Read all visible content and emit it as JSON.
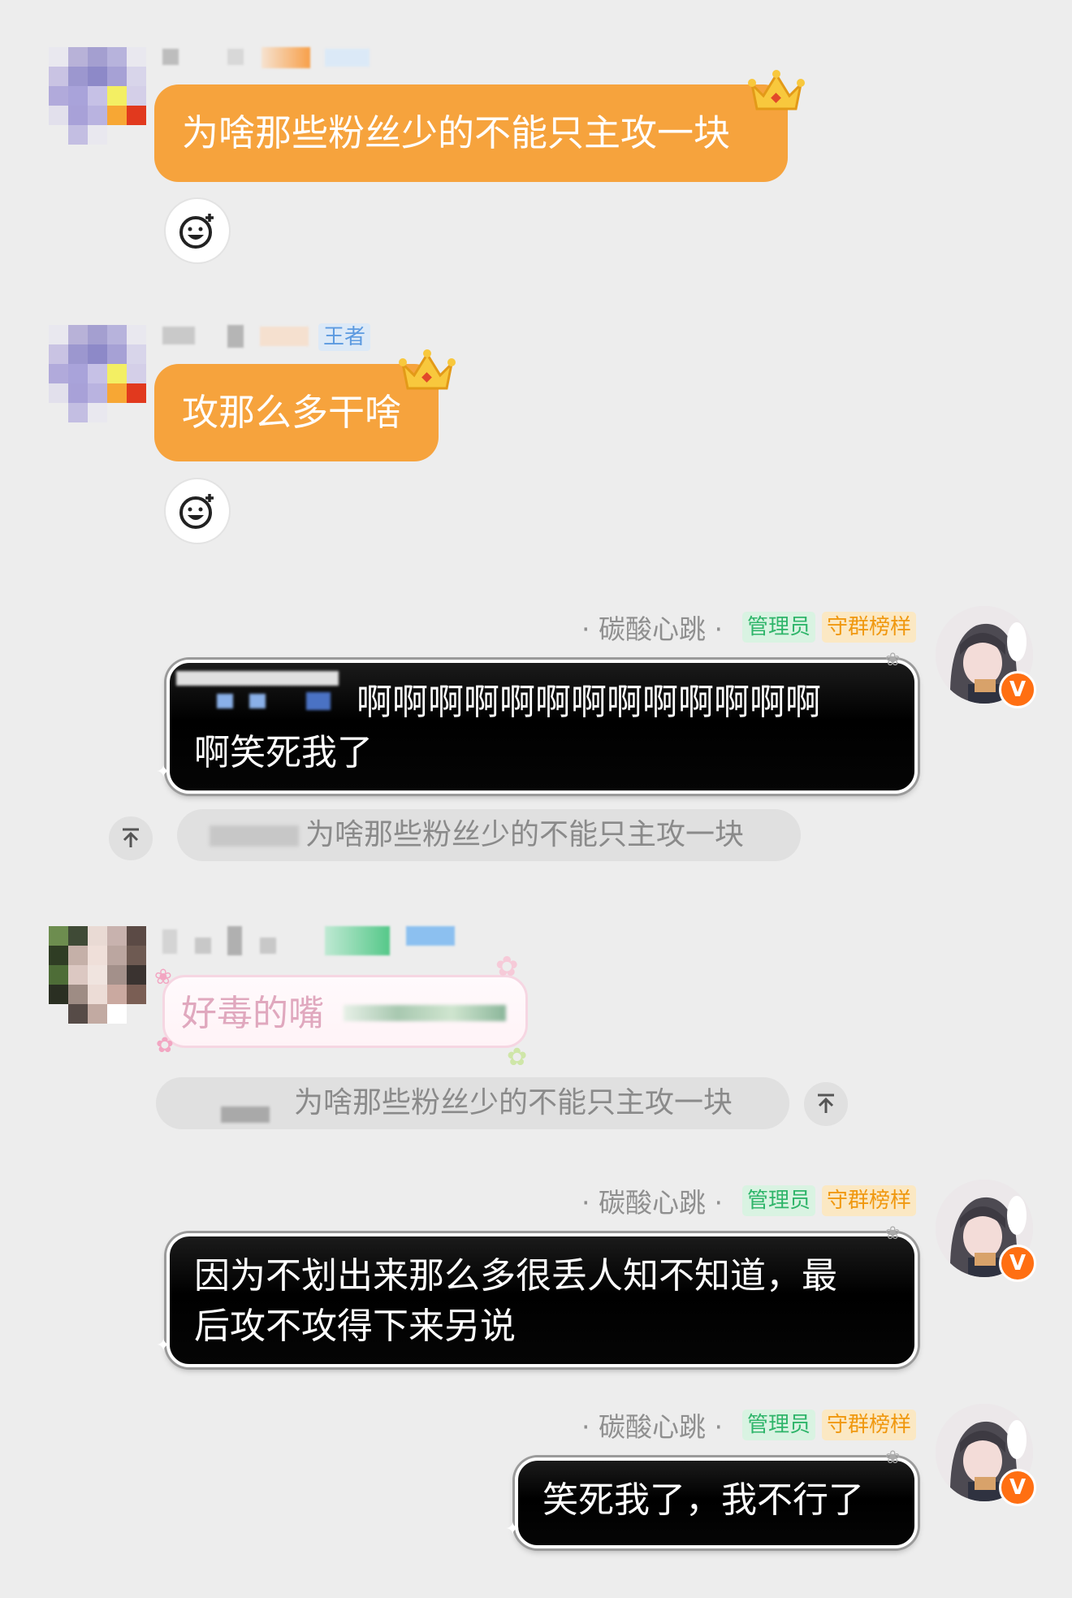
{
  "messages": [
    {
      "side": "left",
      "style": "orange",
      "text": "为啥那些粉丝少的不能只主攻一块"
    },
    {
      "side": "left",
      "style": "orange",
      "tag": "王者",
      "text": "攻那么多干啥"
    },
    {
      "side": "right",
      "sender": "· 碳酸心跳 ·",
      "badges": [
        "管理员",
        "守群榜样"
      ],
      "text_line1": "啊啊啊啊啊啊啊啊啊啊啊啊啊",
      "text_line2": "啊笑死我了",
      "quote": "为啥那些粉丝少的不能只主攻一块"
    },
    {
      "side": "left",
      "style": "pink",
      "text": "好毒的嘴",
      "quote": "为啥那些粉丝少的不能只主攻一块"
    },
    {
      "side": "right",
      "sender": "· 碳酸心跳 ·",
      "badges": [
        "管理员",
        "守群榜样"
      ],
      "text_line1": "因为不划出来那么多很丢人知不知道，最",
      "text_line2": "后攻不攻得下来另说"
    },
    {
      "side": "right",
      "sender": "· 碳酸心跳 ·",
      "badges": [
        "管理员",
        "守群榜样"
      ],
      "text_line1": "笑死我了，我不行了"
    }
  ],
  "icons": {
    "reaction": "emoji-add-icon",
    "quote_jump": "arrow-up-icon",
    "vip": "v-badge-icon"
  },
  "colors": {
    "background": "#ededed",
    "orange_bubble": "#f6a33d",
    "admin_badge": "#2fb56a",
    "guard_badge": "#f0980f"
  },
  "vip_letter": "V"
}
